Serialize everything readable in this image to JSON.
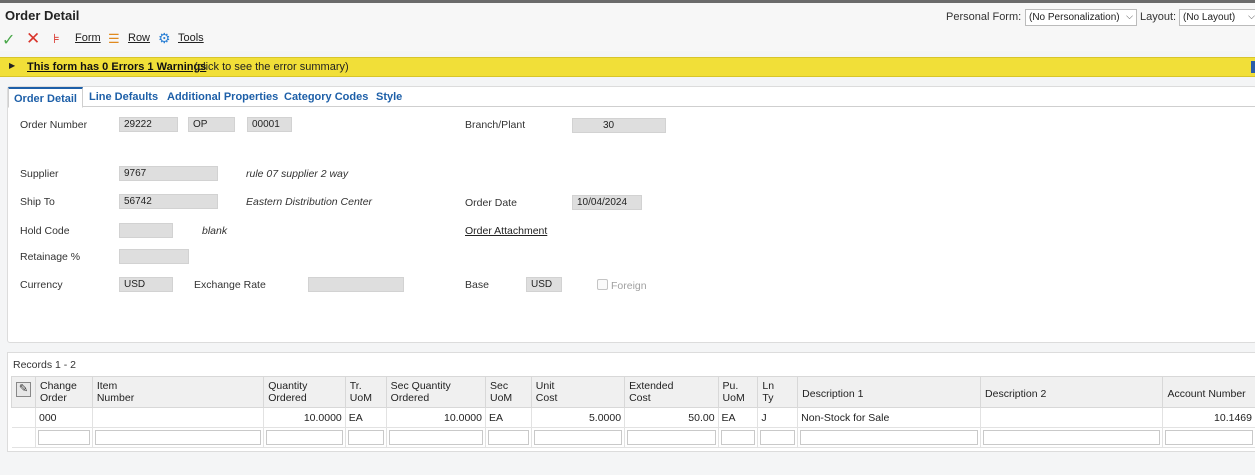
{
  "header": {
    "title": "Order Detail",
    "personal_form_label": "Personal Form:",
    "personal_form_value": "(No Personalization)",
    "layout_label": "Layout:",
    "layout_value": "(No Layout)"
  },
  "toolbar": {
    "form_label": "Form",
    "row_label": "Row",
    "tools_label": "Tools"
  },
  "warning": {
    "link_text": "This form has 0 Errors 1 Warnings",
    "rest_text": "(click to see the error summary)"
  },
  "tabs": [
    {
      "label": "Order Detail",
      "active": true
    },
    {
      "label": "Line Defaults"
    },
    {
      "label": "Additional Properties"
    },
    {
      "label": "Category Codes"
    },
    {
      "label": "Style"
    }
  ],
  "form": {
    "order_number_label": "Order Number",
    "order_number": "29222",
    "order_type": "OP",
    "order_company": "00001",
    "branch_plant_label": "Branch/Plant",
    "branch_plant": "30",
    "supplier_label": "Supplier",
    "supplier": "9767",
    "supplier_desc": "rule 07 supplier 2 way",
    "ship_to_label": "Ship To",
    "ship_to": "56742",
    "ship_to_desc": "Eastern Distribution Center",
    "order_date_label": "Order Date",
    "order_date": "10/04/2024",
    "hold_code_label": "Hold Code",
    "hold_code": "",
    "hold_code_desc": "blank",
    "order_attachment_link": "Order Attachment",
    "retainage_label": "Retainage %",
    "retainage": "",
    "currency_label": "Currency",
    "currency": "USD",
    "exchange_rate_label": "Exchange Rate",
    "exchange_rate": "",
    "base_label": "Base",
    "base": "USD",
    "foreign_label": "Foreign",
    "foreign_checked": false
  },
  "grid": {
    "records_label": "Records 1 - 2",
    "columns": [
      [
        "Change",
        "Order"
      ],
      [
        "Item",
        "Number"
      ],
      [
        "Quantity",
        "Ordered"
      ],
      [
        "Tr.",
        "UoM"
      ],
      [
        "Sec Quantity",
        "Ordered"
      ],
      [
        "Sec",
        "UoM"
      ],
      [
        "Unit",
        "Cost"
      ],
      [
        "Extended",
        "Cost"
      ],
      [
        "Pu.",
        "UoM"
      ],
      [
        "Ln",
        "Ty"
      ],
      [
        "Description 1",
        ""
      ],
      [
        "Description 2",
        ""
      ],
      [
        "Account Number",
        ""
      ]
    ],
    "rows": [
      [
        "000",
        "",
        "10.0000",
        "EA",
        "10.0000",
        "EA",
        "5.0000",
        "50.00",
        "EA",
        "J",
        "Non-Stock for Sale",
        "",
        "10.1469"
      ]
    ]
  }
}
